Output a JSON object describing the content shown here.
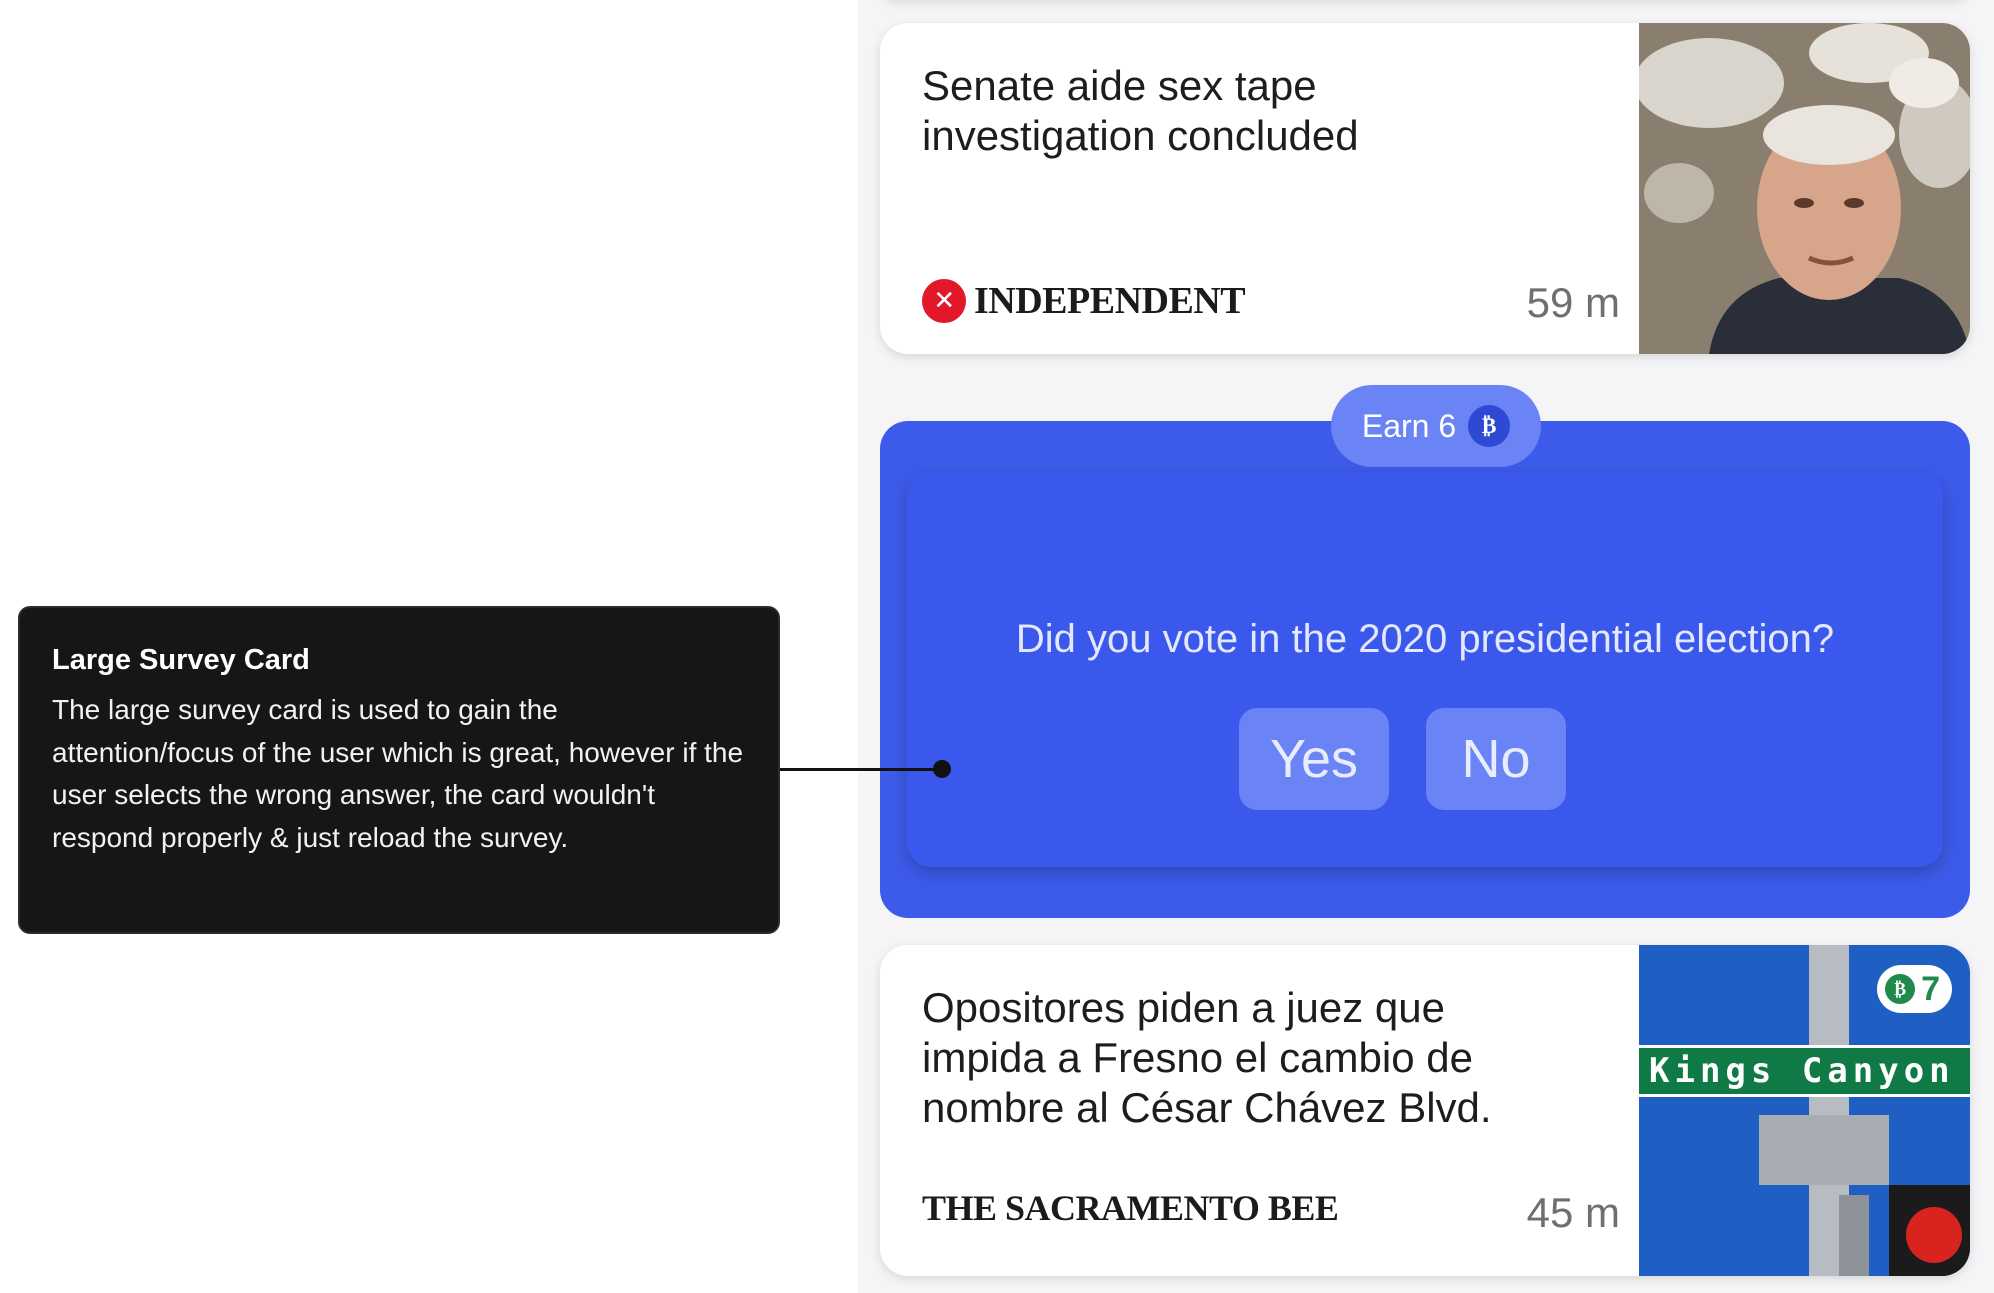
{
  "cards": [
    {
      "headline": "Senate aide sex tape investigation concluded",
      "source": "INDEPENDENT",
      "source_logo": "eagle-icon",
      "time": "59 m"
    },
    {
      "headline": "Opositores piden a juez que impida a Fresno el cambio de nombre al César Chávez Blvd.",
      "source": "THE SACRAMENTO BEE",
      "time": "45 m",
      "reward_badge": "7",
      "photo_sign_text": "Kings Canyon"
    }
  ],
  "survey": {
    "earn_label": "Earn 6",
    "reward_icon": "coin-icon",
    "question": "Did you vote in the 2020 presidential election?",
    "yes_label": "Yes",
    "no_label": "No"
  },
  "annotation": {
    "title": "Large Survey Card",
    "body": "The large survey card is used to gain the attention/focus of the user which is great, however if the user selects the wrong answer, the card wouldn't respond properly & just reload the survey."
  },
  "colors": {
    "survey_blue": "#3d5bea",
    "survey_button": "#6a84f6",
    "independent_red": "#e3172a",
    "sign_green": "#0f7a45"
  }
}
